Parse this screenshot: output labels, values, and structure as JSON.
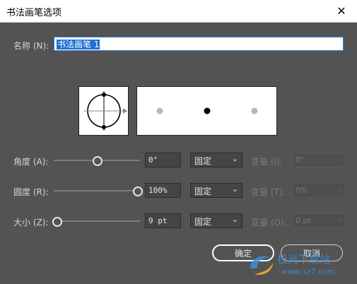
{
  "window": {
    "title": "书法画笔选项",
    "close_symbol": "✕"
  },
  "name": {
    "label": "名称 (N):",
    "value": "书法画笔 1"
  },
  "rows": [
    {
      "label": "角度 (A):",
      "value": "0°",
      "mode": "固定",
      "var_label": "变量 (I):",
      "var_value": "0°",
      "slider_fraction": 0.5
    },
    {
      "label": "圆度 (R):",
      "value": "100%",
      "mode": "固定",
      "var_label": "变量 (T):",
      "var_value": "0%",
      "slider_fraction": 1.0
    },
    {
      "label": "大小 (Z):",
      "value": "9 pt",
      "mode": "固定",
      "var_label": "变量 (O):",
      "var_value": "0 pt",
      "slider_fraction": 0.0
    }
  ],
  "buttons": {
    "ok": "确定",
    "cancel": "取消"
  },
  "watermark": {
    "text": "极光下载站",
    "url": "www.xz7.com"
  },
  "icons": {
    "dropdown": "chevron-down-icon",
    "disabled_dropdown": "chevron-right-icon"
  }
}
